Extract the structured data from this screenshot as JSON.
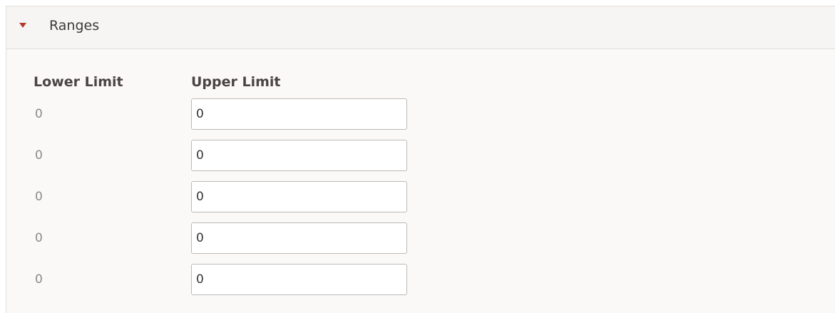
{
  "section": {
    "title": "Ranges",
    "expanded": true,
    "caret_icon": "caret-down-icon",
    "caret_color": "#b23a2a"
  },
  "table": {
    "headers": {
      "lower": "Lower Limit",
      "upper": "Upper Limit"
    },
    "rows": [
      {
        "lower": "0",
        "upper": "0"
      },
      {
        "lower": "0",
        "upper": "0"
      },
      {
        "lower": "0",
        "upper": "0"
      },
      {
        "lower": "0",
        "upper": "0"
      },
      {
        "lower": "0",
        "upper": "0"
      }
    ]
  }
}
